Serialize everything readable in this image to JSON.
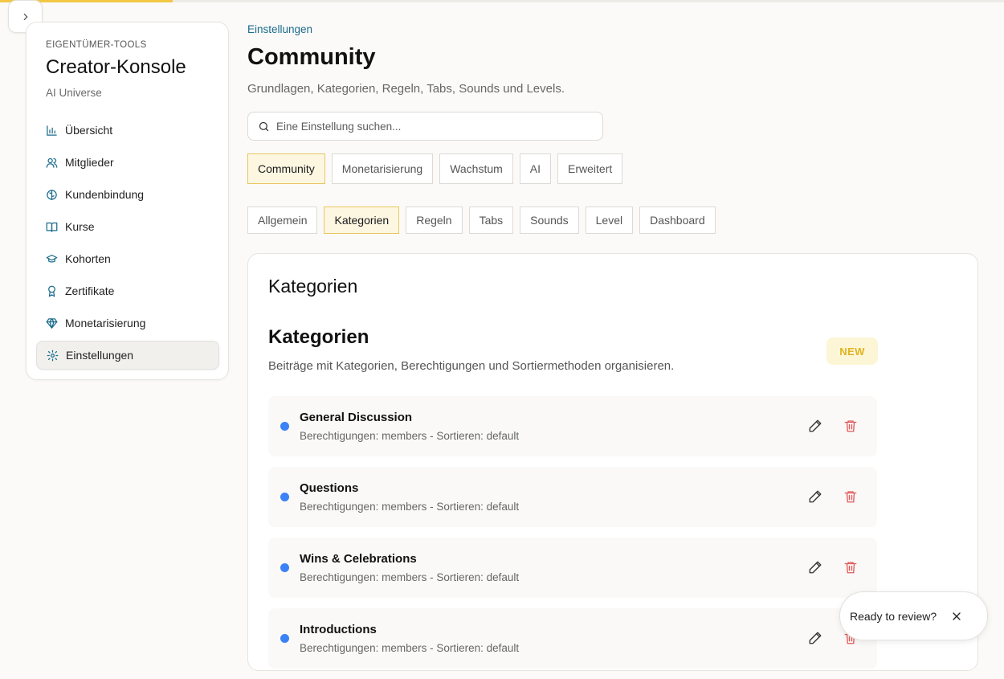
{
  "colors": {
    "accent": "#f2c744",
    "link": "#1a6b8c",
    "dot": "#3b82f6",
    "delete": "#e05a5a"
  },
  "sidebar": {
    "toggle_icon": "chevron-right-icon",
    "kicker": "EIGENTÜMER-TOOLS",
    "title": "Creator-Konsole",
    "subtitle": "AI Universe",
    "items": [
      {
        "label": "Übersicht",
        "icon": "bar-chart-icon"
      },
      {
        "label": "Mitglieder",
        "icon": "users-icon"
      },
      {
        "label": "Kundenbindung",
        "icon": "brain-icon"
      },
      {
        "label": "Kurse",
        "icon": "book-icon"
      },
      {
        "label": "Kohorten",
        "icon": "graduation-cap-icon"
      },
      {
        "label": "Zertifikate",
        "icon": "award-icon"
      },
      {
        "label": "Monetarisierung",
        "icon": "gem-icon"
      },
      {
        "label": "Einstellungen",
        "icon": "gear-icon",
        "active": true
      }
    ]
  },
  "main": {
    "breadcrumb": "Einstellungen",
    "title": "Community",
    "subtitle": "Grundlagen, Kategorien, Regeln, Tabs, Sounds und Levels.",
    "search": {
      "placeholder": "Eine Einstellung suchen..."
    },
    "primary_tabs": [
      "Community",
      "Monetarisierung",
      "Wachstum",
      "AI",
      "Erweitert"
    ],
    "primary_active": 0,
    "secondary_tabs": [
      "Allgemein",
      "Kategorien",
      "Regeln",
      "Tabs",
      "Sounds",
      "Level",
      "Dashboard"
    ],
    "secondary_active": 1,
    "card": {
      "title": "Kategorien",
      "section_title": "Kategorien",
      "section_desc": "Beiträge mit Kategorien, Berechtigungen und Sortiermethoden organisieren.",
      "badge": "NEW",
      "categories": [
        {
          "name": "General Discussion",
          "meta": "Berechtigungen: members - Sortieren: default"
        },
        {
          "name": "Questions",
          "meta": "Berechtigungen: members - Sortieren: default"
        },
        {
          "name": "Wins & Celebrations",
          "meta": "Berechtigungen: members - Sortieren: default"
        },
        {
          "name": "Introductions",
          "meta": "Berechtigungen: members - Sortieren: default"
        }
      ]
    }
  },
  "toast": {
    "message": "Ready to review?"
  }
}
